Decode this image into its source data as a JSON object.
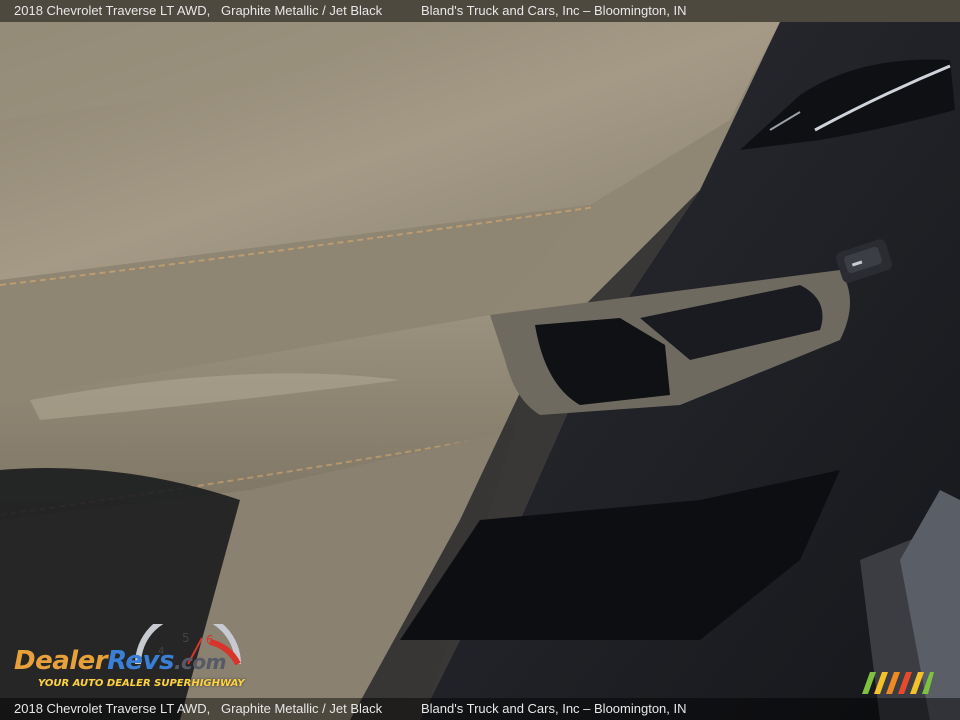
{
  "caption": {
    "model": "2018 Chevrolet Traverse LT AWD,",
    "color": "Graphite Metallic / Jet Black",
    "dealer": "Bland's Truck and Cars, Inc – Bloomington, IN"
  },
  "watermark": {
    "brand_a": "Dealer",
    "brand_b": "Revs",
    "brand_c": ".com",
    "tagline": "YOUR AUTO DEALER SUPERHIGHWAY",
    "gauge_digits": [
      "4",
      "5",
      "6"
    ]
  },
  "colors": {
    "leather_light": "#a59c88",
    "leather_mid": "#857c6b",
    "plastic_dark": "#1e2025",
    "stitch": "#c8a16f",
    "brand_orange": "#e8a03a",
    "brand_blue": "#3a7fd6"
  }
}
